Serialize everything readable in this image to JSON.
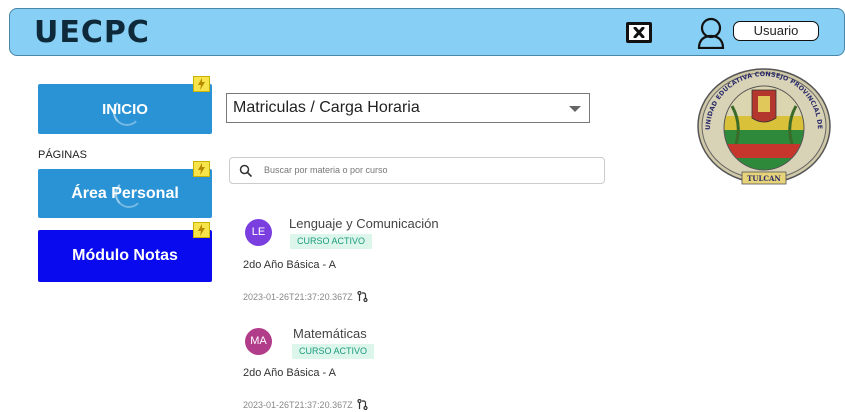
{
  "header": {
    "logo": "UECPC",
    "close_icon": "close-square-icon",
    "user_icon": "user-outline-icon",
    "user_label": "Usuario",
    "colors": {
      "bar": "#87cff5",
      "border": "#4a86a8"
    }
  },
  "sidebar": {
    "inicio": "INICIO",
    "section_label": "PÁGINAS",
    "area_personal": "Área Personal",
    "modulo_notas": "Módulo Notas",
    "colors": {
      "primary": "#2a93d5",
      "notas": "#0a0aee",
      "badge": "#f7e34a"
    }
  },
  "main": {
    "select_value": "Matriculas / Carga Horaria",
    "search_placeholder": "Buscar por materia o por curso",
    "courses": [
      {
        "initials": "LE",
        "avatar_color": "#7b3fe0",
        "name": "Lenguaje y Comunicación",
        "status": "CURSO ACTIVO",
        "grade": "2do Año Básica - A",
        "date": "2023-01-26T21:37:20.367Z"
      },
      {
        "initials": "MA",
        "avatar_color": "#b03c8a",
        "name": "Matemáticas",
        "status": "CURSO ACTIVO",
        "grade": "2do Año Básica - A",
        "date": "2023-01-26T21:37:20.367Z"
      }
    ]
  },
  "seal": {
    "text_top": "UNIDAD EDUCATIVA CONSEJO PROVINCIAL DEL CARCHI",
    "text_bottom": "TULCAN"
  }
}
